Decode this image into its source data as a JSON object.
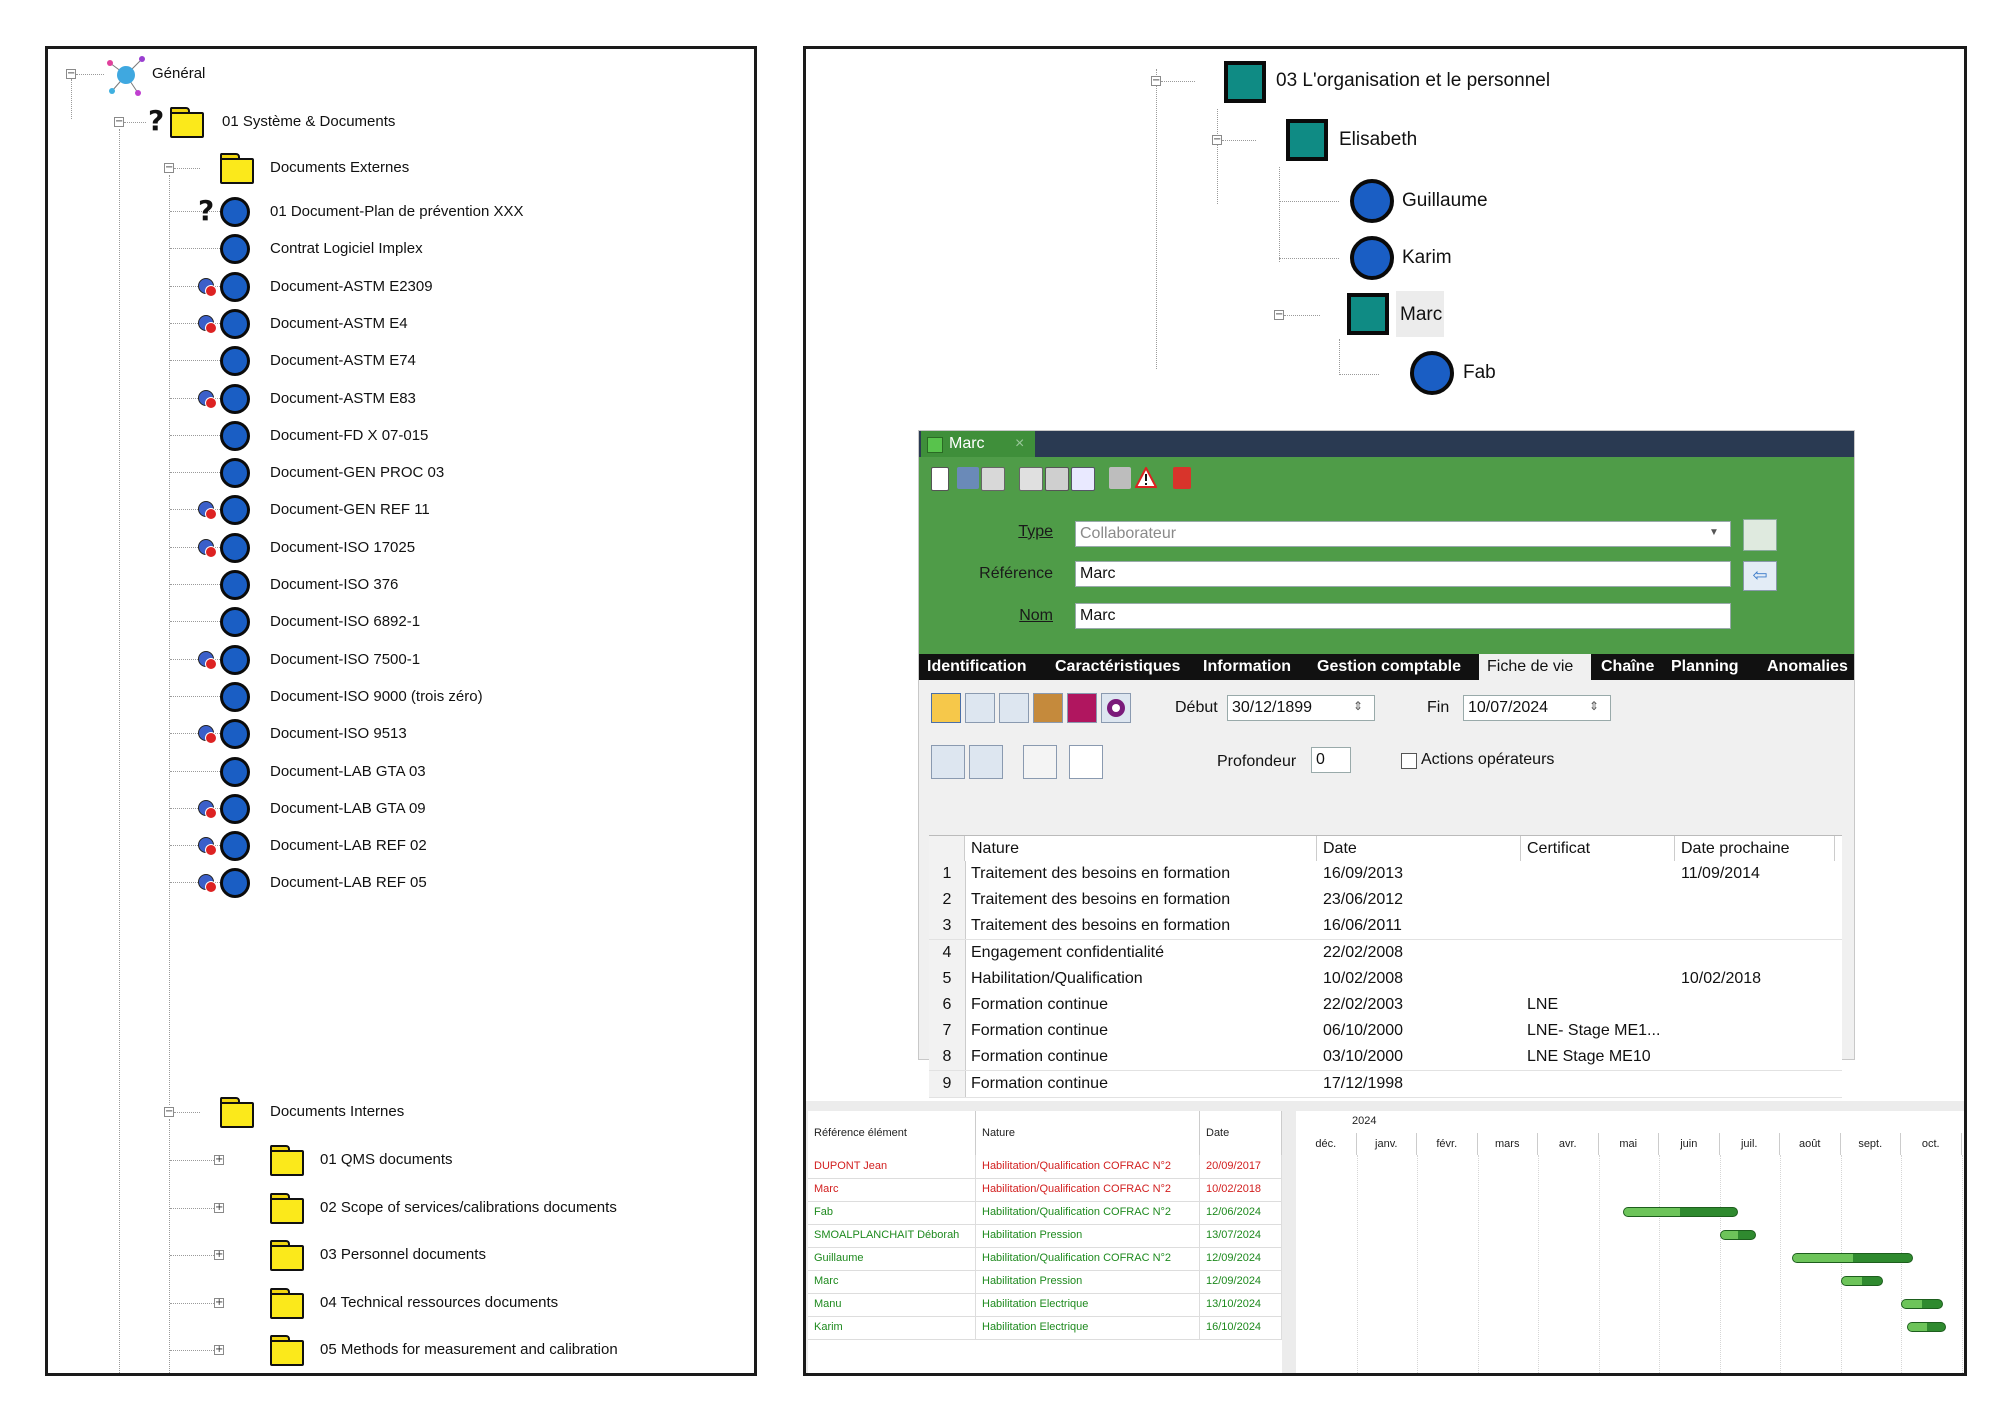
{
  "tree": {
    "root_label": "Général",
    "system_label": "01 Système & Documents",
    "external_folder": "Documents Externes",
    "external_docs": [
      {
        "label": "01 Document-Plan de prévention XXX",
        "marker": "question"
      },
      {
        "label": "Contrat Logiciel Implex",
        "marker": "none"
      },
      {
        "label": "Document-ASTM E2309",
        "marker": "badge"
      },
      {
        "label": "Document-ASTM E4",
        "marker": "badge"
      },
      {
        "label": "Document-ASTM E74",
        "marker": "none"
      },
      {
        "label": "Document-ASTM E83",
        "marker": "badge"
      },
      {
        "label": "Document-FD X 07-015",
        "marker": "none"
      },
      {
        "label": "Document-GEN PROC 03",
        "marker": "none"
      },
      {
        "label": "Document-GEN REF 11",
        "marker": "badge"
      },
      {
        "label": "Document-ISO 17025",
        "marker": "badge"
      },
      {
        "label": "Document-ISO 376",
        "marker": "none"
      },
      {
        "label": "Document-ISO 6892-1",
        "marker": "none"
      },
      {
        "label": "Document-ISO 7500-1",
        "marker": "badge"
      },
      {
        "label": "Document-ISO 9000 (trois zéro)",
        "marker": "none"
      },
      {
        "label": "Document-ISO 9513",
        "marker": "badge"
      },
      {
        "label": "Document-LAB GTA 03",
        "marker": "none"
      },
      {
        "label": "Document-LAB GTA 09",
        "marker": "badge"
      },
      {
        "label": "Document-LAB REF 02",
        "marker": "badge"
      },
      {
        "label": "Document-LAB REF 05",
        "marker": "badge"
      }
    ],
    "internal_folder": "Documents Internes",
    "internal_folders": [
      "01 QMS documents",
      "02 Scope of services/calibrations documents",
      "03 Personnel documents",
      "04 Technical ressources documents",
      "05 Methods for measurement and calibration"
    ]
  },
  "org": {
    "root": "03 L'organisation et le personnel",
    "elisabeth": "Elisabeth",
    "guillaume": "Guillaume",
    "karim": "Karim",
    "marc": "Marc",
    "fab": "Fab"
  },
  "form": {
    "tab_title": "Marc",
    "type_label": "Type",
    "type_value": "Collaborateur",
    "reference_label": "Référence",
    "reference_value": "Marc",
    "nom_label": "Nom",
    "nom_value": "Marc",
    "tabs": [
      "Identification",
      "Caractéristiques",
      "Information",
      "Gestion comptable",
      "Fiche de vie",
      "Chaîne",
      "Planning",
      "Anomalies"
    ],
    "active_tab": "Fiche de vie",
    "debut_label": "Début",
    "debut_value": "30/12/1899",
    "fin_label": "Fin",
    "fin_value": "10/07/2024",
    "profondeur_label": "Profondeur",
    "profondeur_value": "0",
    "actions_label": "Actions opérateurs",
    "columns": [
      "Nature",
      "Date",
      "Certificat",
      "Date prochaine"
    ],
    "rows": [
      {
        "n": "1",
        "nature": "Traitement des besoins en formation",
        "date": "16/09/2013",
        "cert": "",
        "next": "11/09/2014"
      },
      {
        "n": "2",
        "nature": "Traitement des besoins en formation",
        "date": "23/06/2012",
        "cert": "",
        "next": ""
      },
      {
        "n": "3",
        "nature": "Traitement des besoins en formation",
        "date": "16/06/2011",
        "cert": "",
        "next": ""
      },
      {
        "n": "4",
        "nature": "Engagement confidentialité",
        "date": "22/02/2008",
        "cert": "",
        "next": ""
      },
      {
        "n": "5",
        "nature": "Habilitation/Qualification",
        "date": "10/02/2008",
        "cert": "",
        "next": "10/02/2018"
      },
      {
        "n": "6",
        "nature": "Formation continue",
        "date": "22/02/2003",
        "cert": "LNE",
        "next": ""
      },
      {
        "n": "7",
        "nature": "Formation continue",
        "date": "06/10/2000",
        "cert": "LNE- Stage ME1...",
        "next": ""
      },
      {
        "n": "8",
        "nature": "Formation continue",
        "date": "03/10/2000",
        "cert": "LNE Stage ME10",
        "next": ""
      },
      {
        "n": "9",
        "nature": "Formation continue",
        "date": "17/12/1998",
        "cert": "",
        "next": ""
      }
    ]
  },
  "gantt": {
    "col_ref": "Référence élément",
    "col_nature": "Nature",
    "col_date": "Date",
    "year": "2024",
    "months": [
      "déc.",
      "janv.",
      "févr.",
      "mars",
      "avr.",
      "mai",
      "juin",
      "juil.",
      "août",
      "sept.",
      "oct."
    ],
    "colors": {
      "overdue": "#d21f1f",
      "ok": "#1e8a1e",
      "bar_dark": "#2f8a2f",
      "bar_light": "#6dc45a"
    },
    "rows": [
      {
        "ref": "DUPONT Jean",
        "nature": "Habilitation/Qualification COFRAC N°2",
        "date": "20/09/2017",
        "status": "overdue",
        "start_month": null,
        "end_month": null
      },
      {
        "ref": "Marc",
        "nature": "Habilitation/Qualification COFRAC N°2",
        "date": "10/02/2018",
        "status": "overdue",
        "start_month": null,
        "end_month": null
      },
      {
        "ref": "Fab",
        "nature": "Habilitation/Qualification COFRAC N°2",
        "date": "12/06/2024",
        "status": "ok",
        "start_month": 5.4,
        "end_month": 7.3
      },
      {
        "ref": "SMOALPLANCHAIT Déborah",
        "nature": "Habilitation Pression",
        "date": "13/07/2024",
        "status": "ok",
        "start_month": 7.0,
        "end_month": 7.6
      },
      {
        "ref": "Guillaume",
        "nature": "Habilitation/Qualification COFRAC N°2",
        "date": "12/09/2024",
        "status": "ok",
        "start_month": 8.2,
        "end_month": 10.2
      },
      {
        "ref": "Marc",
        "nature": "Habilitation Pression",
        "date": "12/09/2024",
        "status": "ok",
        "start_month": 9.0,
        "end_month": 9.7
      },
      {
        "ref": "Manu",
        "nature": "Habilitation Electrique",
        "date": "13/10/2024",
        "status": "ok",
        "start_month": 10.0,
        "end_month": 10.7
      },
      {
        "ref": "Karim",
        "nature": "Habilitation Electrique",
        "date": "16/10/2024",
        "status": "ok",
        "start_month": 10.1,
        "end_month": 10.75
      }
    ]
  }
}
